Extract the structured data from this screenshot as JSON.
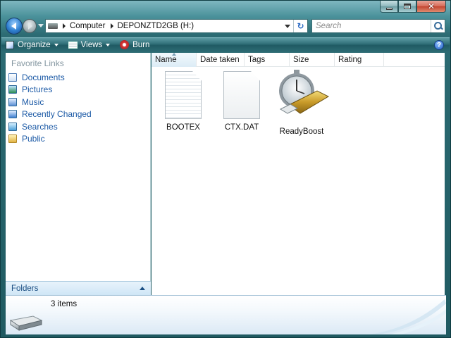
{
  "window": {
    "caption": {
      "minimize_icon": "minimize-icon",
      "maximize_icon": "maximize-icon",
      "close_icon": "close-icon",
      "close_glyph": "✕"
    }
  },
  "navigation": {
    "back_icon": "back-arrow-icon",
    "forward_icon": "forward-arrow-icon",
    "recent_pages_icon": "chevron-down-icon"
  },
  "address_bar": {
    "breadcrumbs": [
      "Computer",
      "DEPONZTD2GB (H:)"
    ],
    "refresh_glyph": "↻"
  },
  "search": {
    "placeholder": "Search"
  },
  "toolbar": {
    "organize_label": "Organize",
    "views_label": "Views",
    "burn_label": "Burn",
    "help_glyph": "?"
  },
  "navigation_pane": {
    "header": "Favorite Links",
    "links": [
      {
        "label": "Documents",
        "icon": "documents-icon"
      },
      {
        "label": "Pictures",
        "icon": "pictures-icon"
      },
      {
        "label": "Music",
        "icon": "music-icon"
      },
      {
        "label": "Recently Changed",
        "icon": "recently-changed-icon"
      },
      {
        "label": "Searches",
        "icon": "searches-icon"
      },
      {
        "label": "Public",
        "icon": "public-folder-icon"
      }
    ],
    "folders_label": "Folders"
  },
  "file_list": {
    "columns": [
      "Name",
      "Date taken",
      "Tags",
      "Size",
      "Rating"
    ],
    "sorted_column": "Name",
    "items": [
      {
        "name": "BOOTEX",
        "icon": "text-document-icon"
      },
      {
        "name": "CTX.DAT",
        "icon": "blank-document-icon"
      },
      {
        "name": "ReadyBoost",
        "icon": "readyboost-icon"
      }
    ]
  },
  "details_pane": {
    "item_count": "3 items",
    "icon": "usb-drive-icon"
  },
  "colors": {
    "chrome_teal": "#2c6b73",
    "link_blue": "#1c5aa6",
    "close_red": "#c24530"
  }
}
